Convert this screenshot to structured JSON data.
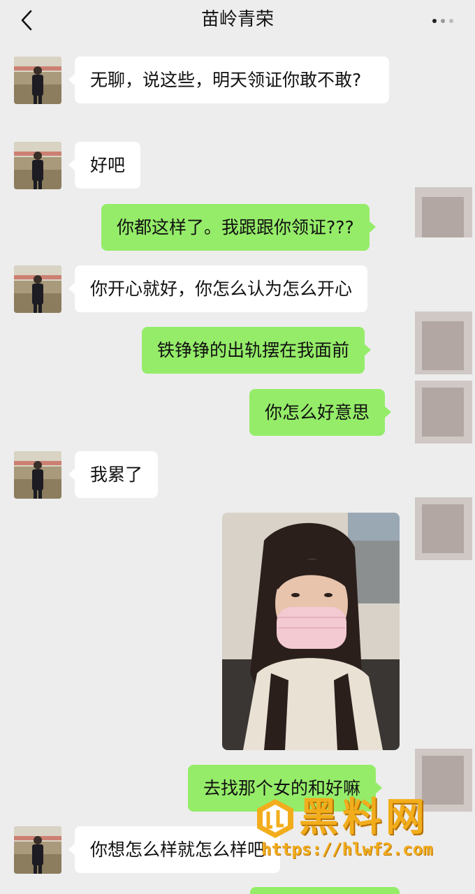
{
  "header": {
    "title": "苗岭青荣",
    "back_icon": "chevron-left-icon",
    "more_icon": "more-dots-icon"
  },
  "messages": [
    {
      "side": "left",
      "text": "无聊，说这些，明天领证你敢不敢?"
    },
    {
      "side": "left",
      "text": "好吧"
    },
    {
      "side": "right",
      "text": "你都这样了。我跟跟你领证???"
    },
    {
      "side": "left",
      "text": "你开心就好，你怎么认为怎么开心"
    },
    {
      "side": "right",
      "text": "铁铮铮的出轨摆在我面前"
    },
    {
      "side": "right",
      "text": "你怎么好意思"
    },
    {
      "side": "left",
      "text": "我累了"
    },
    {
      "side": "right",
      "type": "image",
      "description_icon": "photo-message-icon"
    },
    {
      "side": "right",
      "text": "去找那个女的和好嘛"
    },
    {
      "side": "left",
      "text": "你想怎么样就怎么样吧"
    }
  ],
  "watermark": {
    "brand": "黑料网",
    "url": "https://hlwf2.com"
  },
  "colors": {
    "background": "#ededed",
    "bubble_self": "#95ec69",
    "bubble_other": "#ffffff",
    "watermark": "#f2ad1c"
  }
}
